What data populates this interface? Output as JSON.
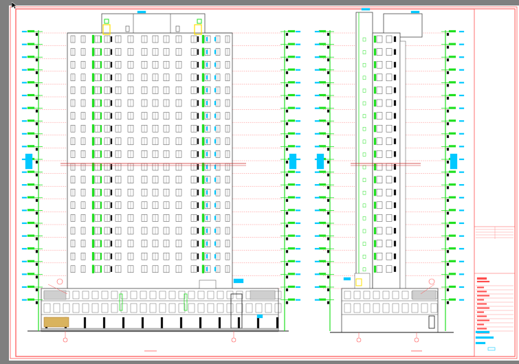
{
  "canvas": {
    "background": "#7f7f7f",
    "paper": "#ffffff",
    "colors": {
      "frame": "#ff4d4d",
      "outline": "#444444",
      "grid": "#ff2a2a",
      "floor_line": "#cc2222",
      "green": "#20e020",
      "cyan": "#00c8ff",
      "yellow": "#ffe000",
      "dark": "#111111",
      "hatch": "#777777",
      "brown": "#b07a28"
    }
  },
  "drawing": {
    "front_elevation": {
      "floors": 20,
      "window_bays": 12,
      "label": ""
    },
    "side_elevation": {
      "floors": 20,
      "window_bays": 2,
      "label": ""
    },
    "title_block": {
      "rows": 12,
      "label": ""
    }
  }
}
